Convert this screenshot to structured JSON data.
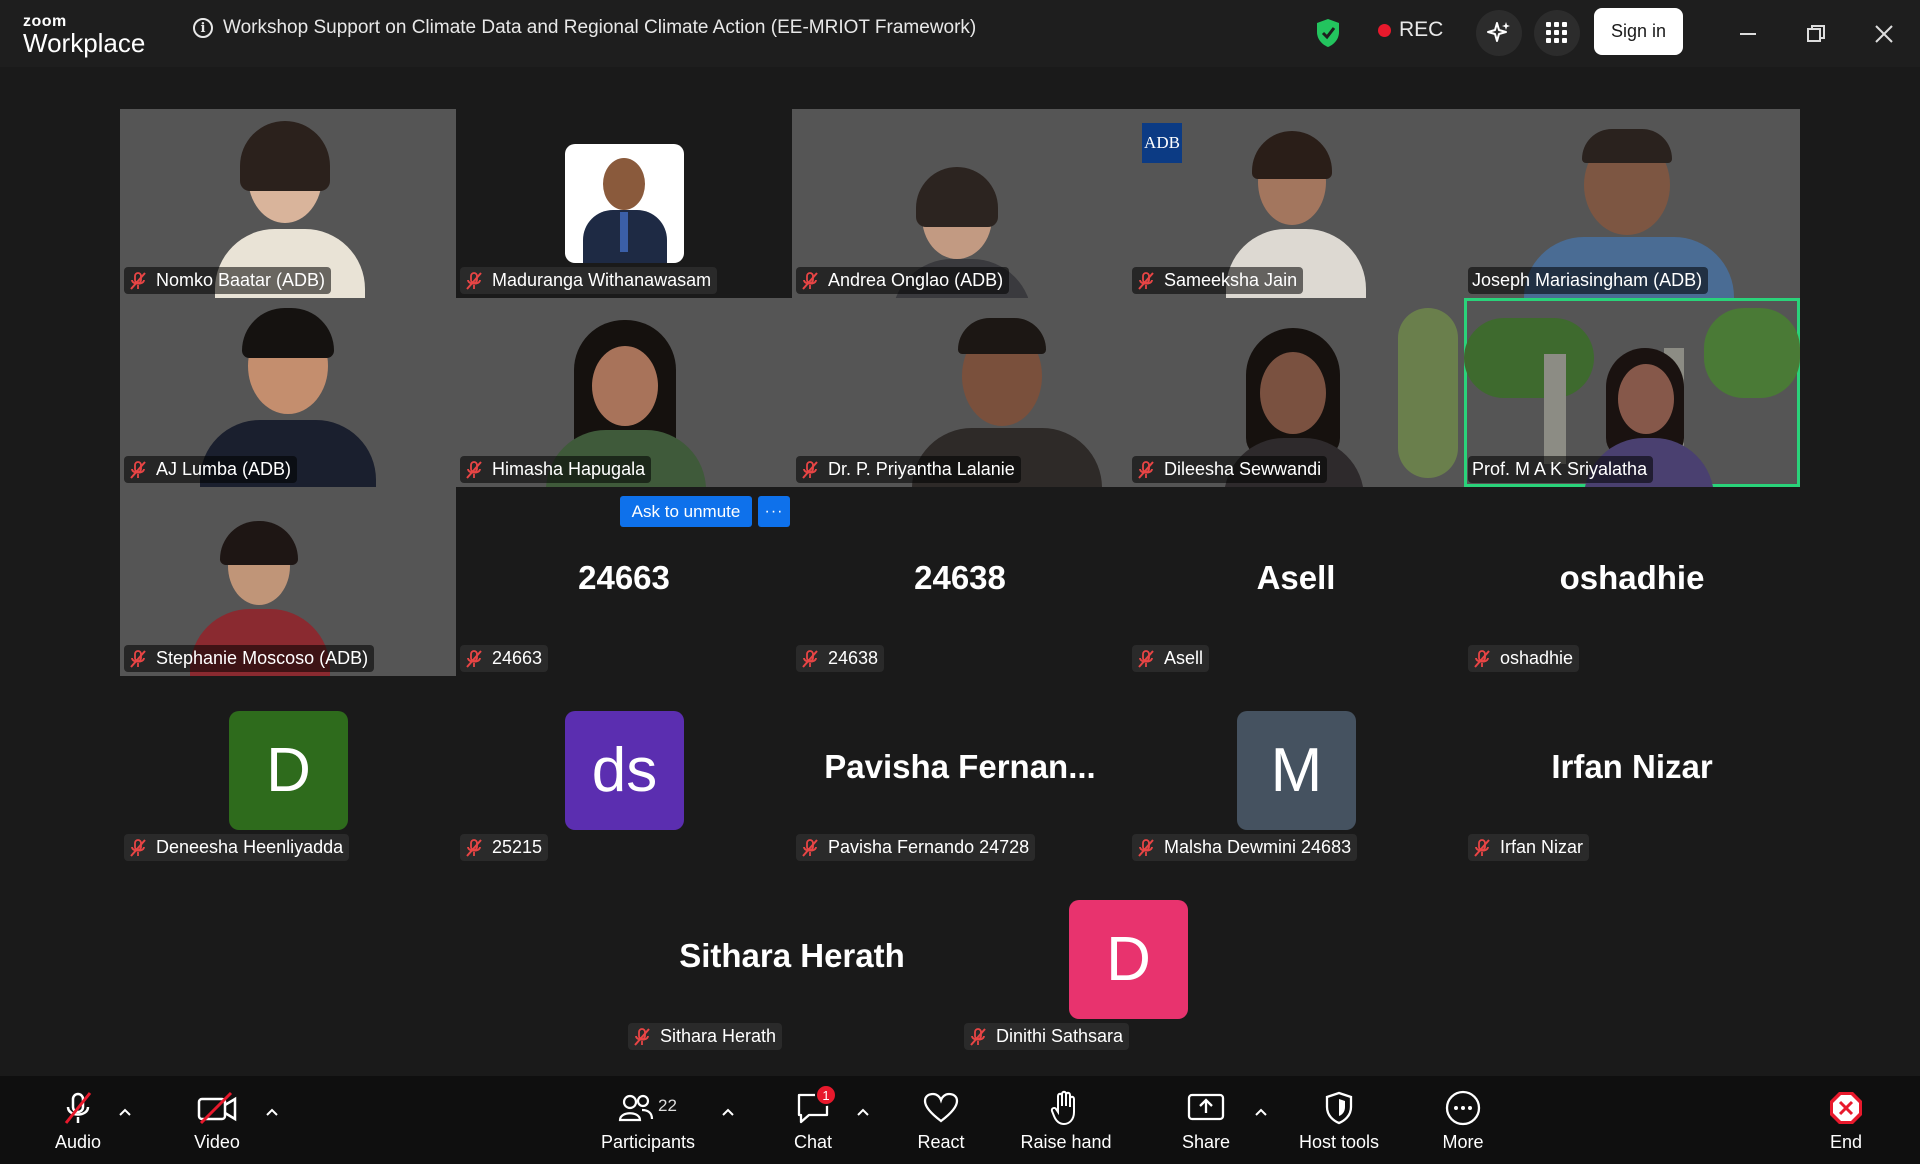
{
  "app": {
    "logo_small": "zoom",
    "logo_big": "Workplace"
  },
  "meeting": {
    "title": "Workshop Support on Climate Data and Regional Climate Action (EE-MRIOT Framework)"
  },
  "header": {
    "rec_label": "REC",
    "signin_label": "Sign in"
  },
  "participants": [
    {
      "name": "Nomko Baatar (ADB)"
    },
    {
      "name": "Maduranga Withanawasam"
    },
    {
      "name": "Andrea Onglao (ADB)"
    },
    {
      "name": "Sameeksha Jain"
    },
    {
      "name": "Joseph Mariasingham (ADB)"
    },
    {
      "name": "AJ Lumba (ADB)"
    },
    {
      "name": "Himasha Hapugala"
    },
    {
      "name": "Dr. P. Priyantha Lalanie"
    },
    {
      "name": "Dileesha Sewwandi"
    },
    {
      "name": "Prof. M A K Sriyalatha"
    },
    {
      "name": "Stephanie Moscoso (ADB)"
    },
    {
      "name": "24663",
      "display": "24663"
    },
    {
      "name": "24638",
      "display": "24638"
    },
    {
      "name": "Asell",
      "display": "Asell"
    },
    {
      "name": "oshadhie",
      "display": "oshadhie"
    },
    {
      "name": "Deneesha Heenliyadda",
      "initial": "D",
      "color": "#2e6b1c"
    },
    {
      "name": "25215",
      "initial": "ds",
      "color": "#5b2eb0"
    },
    {
      "name": "Pavisha Fernando 24728",
      "display": "Pavisha  Fernan..."
    },
    {
      "name": "Malsha Dewmini 24683",
      "initial": "M",
      "color": "#455260"
    },
    {
      "name": "Irfan Nizar",
      "display": "Irfan Nizar"
    },
    {
      "name": "Sithara Herath",
      "display": "Sithara Herath"
    },
    {
      "name": "Dinithi Sathsara",
      "initial": "D",
      "color": "#e8336e"
    }
  ],
  "hover_actions": {
    "ask_unmute": "Ask to unmute",
    "more": "···"
  },
  "adb_logo": "ADB",
  "toolbar": {
    "audio": "Audio",
    "video": "Video",
    "participants": "Participants",
    "participants_count": "22",
    "chat": "Chat",
    "chat_badge": "1",
    "react": "React",
    "raise_hand": "Raise hand",
    "share": "Share",
    "host_tools": "Host tools",
    "more": "More",
    "end": "End"
  }
}
